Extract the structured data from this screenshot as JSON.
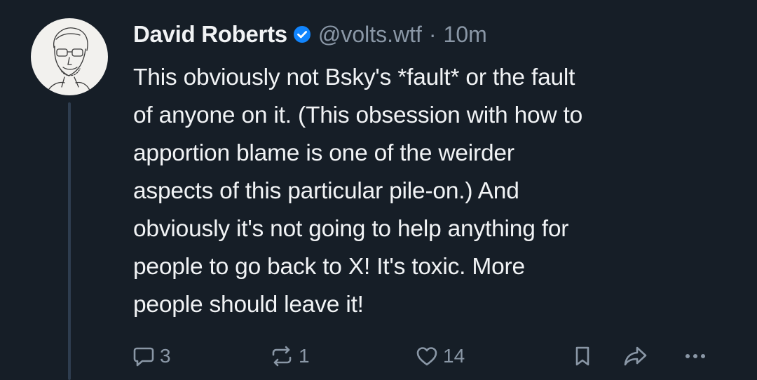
{
  "post": {
    "author": {
      "display_name": "David Roberts",
      "handle": "@volts.wtf",
      "verified": true
    },
    "separator": "·",
    "timestamp": "10m",
    "text": "This obviously not Bsky's *fault* or the fault\nof anyone on it. (This obsession with how to\napportion blame is one of the weirder\naspects of this particular pile-on.) And\nobviously it's not going to help anything for\npeople to go back to X! It's toxic. More\npeople should leave it!",
    "actions": {
      "reply_count": "3",
      "repost_count": "1",
      "like_count": "14"
    }
  },
  "icons": {
    "verified": "verified-badge-icon",
    "reply": "reply-bubble-icon",
    "repost": "repost-icon",
    "like": "heart-icon",
    "bookmark": "bookmark-icon",
    "share": "share-arrow-icon",
    "more": "more-dots-icon"
  },
  "colors": {
    "background": "#161e27",
    "text_primary": "#f1f3f5",
    "text_secondary": "#8a97a6",
    "verified_blue": "#1185fe",
    "thread_line": "#2e3d4f"
  }
}
